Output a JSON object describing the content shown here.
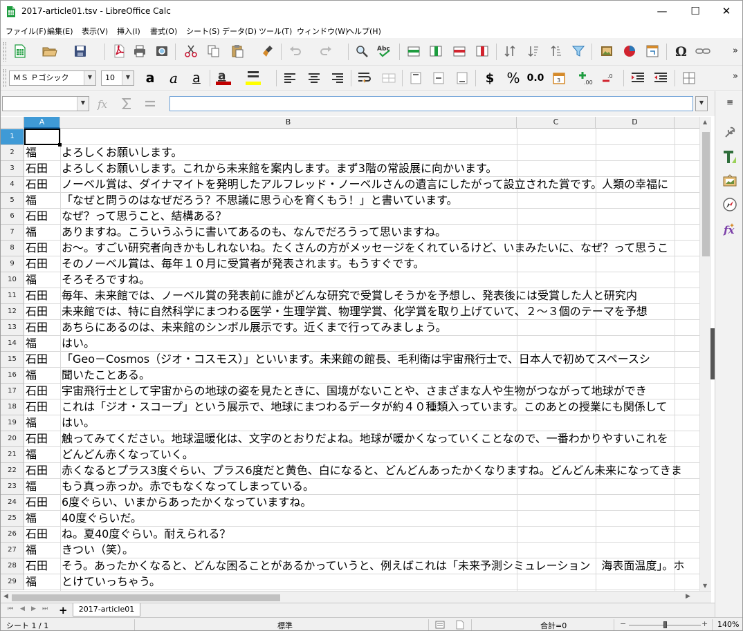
{
  "window": {
    "title": "2017-article01.tsv - LibreOffice Calc",
    "minimize": "—",
    "maximize": "☐",
    "close": "✕"
  },
  "menu": [
    "ファイル(F)",
    "編集(E)",
    "表示(V)",
    "挿入(I)",
    "書式(O)",
    "シート(S)",
    "データ(D)",
    "ツール(T)",
    "ウィンドウ(W)",
    "ヘルプ(H)"
  ],
  "toolbar2": {
    "font_name": "ＭＳ Ｐゴシック",
    "font_size": "10",
    "currency": "$",
    "percent": "%",
    "decimal": "0.0"
  },
  "formula_bar": {
    "name_box": "",
    "formula": ""
  },
  "columns": [
    "A",
    "B",
    "C",
    "D"
  ],
  "rows": [
    {
      "num": "1",
      "a": "",
      "b": ""
    },
    {
      "num": "2",
      "a": "福",
      "b": "よろしくお願いします。"
    },
    {
      "num": "3",
      "a": "石田",
      "b": "よろしくお願いします。これから未来館を案内します。まず3階の常設展に向かいます。"
    },
    {
      "num": "4",
      "a": "石田",
      "b": "ノーベル賞は、ダイナマイトを発明したアルフレッド・ノーベルさんの遺言にしたがって設立された賞です。人類の幸福に"
    },
    {
      "num": "5",
      "a": "福",
      "b": "「なぜと問うのはなぜだろう？不思議に思う心を育くもう！」と書いています。"
    },
    {
      "num": "6",
      "a": "石田",
      "b": "なぜ？って思うこと、結構ある？"
    },
    {
      "num": "7",
      "a": "福",
      "b": "ありますね。こういうふうに書いてあるのも、なんでだろうって思いますね。"
    },
    {
      "num": "8",
      "a": "石田",
      "b": "お～。すごい研究者向きかもしれないね。たくさんの方がメッセージをくれているけど、いまみたいに、なぜ？って思うこ"
    },
    {
      "num": "9",
      "a": "石田",
      "b": "そのノーベル賞は、毎年１０月に受賞者が発表されます。もうすぐです。"
    },
    {
      "num": "10",
      "a": "福",
      "b": "そろそろですね。"
    },
    {
      "num": "11",
      "a": "石田",
      "b": "毎年、未来館では、ノーベル賞の発表前に誰がどんな研究で受賞しそうかを予想し、発表後には受賞した人と研究内"
    },
    {
      "num": "12",
      "a": "石田",
      "b": "未来館では、特に自然科学にまつわる医学・生理学賞、物理学賞、化学賞を取り上げていて、２～３個のテーマを予想"
    },
    {
      "num": "13",
      "a": "石田",
      "b": "あちらにあるのは、未来館のシンボル展示です。近くまで行ってみましょう。"
    },
    {
      "num": "14",
      "a": "福",
      "b": "はい。"
    },
    {
      "num": "15",
      "a": "石田",
      "b": "「Geo－Cosmos（ジオ・コスモス）」といいます。未来館の館長、毛利衛は宇宙飛行士で、日本人で初めてスペースシ"
    },
    {
      "num": "16",
      "a": "福",
      "b": "聞いたことある。"
    },
    {
      "num": "17",
      "a": "石田",
      "b": "宇宙飛行士として宇宙からの地球の姿を見たときに、国境がないことや、さまざまな人や生物がつながって地球ができ"
    },
    {
      "num": "18",
      "a": "石田",
      "b": "これは「ジオ・スコープ」という展示で、地球にまつわるデータが約４０種類入っています。このあとの授業にも関係して"
    },
    {
      "num": "19",
      "a": "福",
      "b": "はい。"
    },
    {
      "num": "20",
      "a": "石田",
      "b": "触ってみてください。地球温暖化は、文字のとおりだよね。地球が暖かくなっていくことなので、一番わかりやすいこれを"
    },
    {
      "num": "21",
      "a": "福",
      "b": "どんどん赤くなっていく。"
    },
    {
      "num": "22",
      "a": "石田",
      "b": "赤くなるとプラス3度ぐらい、プラス6度だと黄色、白になると、どんどんあったかくなりますね。どんどん未来になってきま"
    },
    {
      "num": "23",
      "a": "福",
      "b": "もう真っ赤っか。赤でもなくなってしまっている。"
    },
    {
      "num": "24",
      "a": "石田",
      "b": "6度ぐらい、いまからあったかくなっていますね。"
    },
    {
      "num": "25",
      "a": "福",
      "b": "40度ぐらいだ。"
    },
    {
      "num": "26",
      "a": "石田",
      "b": "ね。夏40度ぐらい。耐えられる？"
    },
    {
      "num": "27",
      "a": "福",
      "b": "きつい（笑）。"
    },
    {
      "num": "28",
      "a": "石田",
      "b": "そう。あったかくなると、どんな困ることがあるかっていうと、例えばこれは「未来予測シミュレーション　海表面温度」。ホ"
    },
    {
      "num": "29",
      "a": "福",
      "b": "とけていっちゃう。"
    }
  ],
  "sheet_tab": "2017-article01",
  "status": {
    "sheet": "シート 1 / 1",
    "style": "標準",
    "sum": "合計=0",
    "zoom": "140%"
  }
}
